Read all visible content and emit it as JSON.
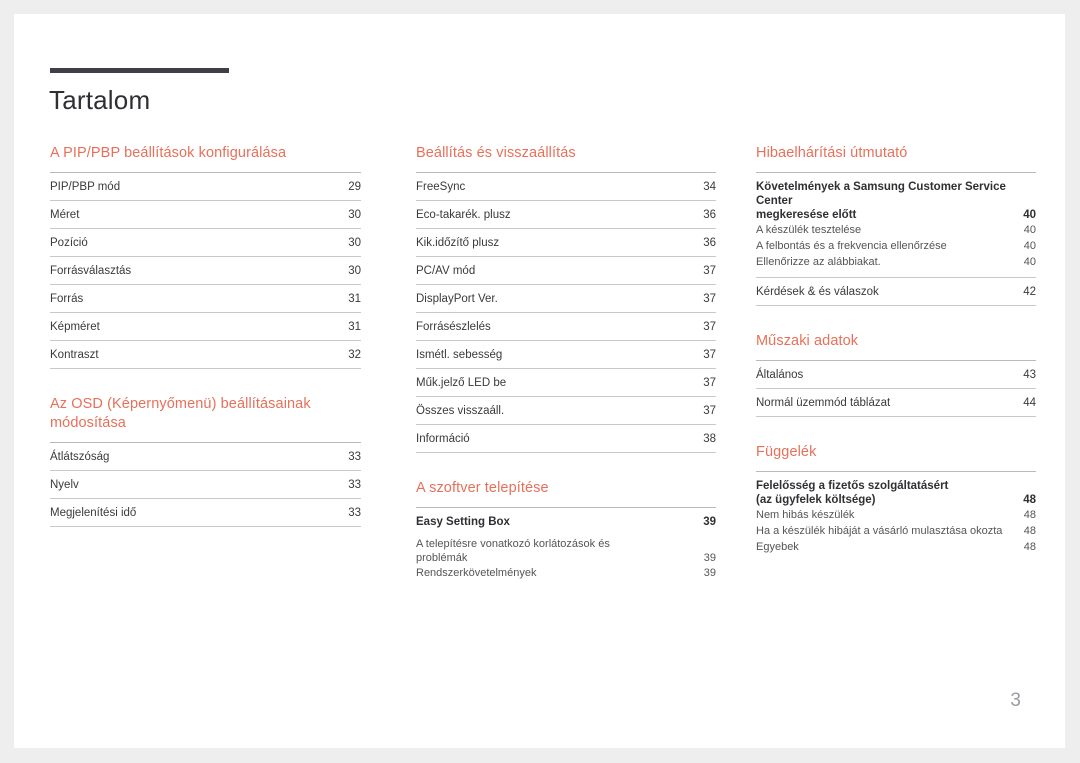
{
  "document": {
    "title": "Tartalom",
    "page_number": "3",
    "accent_color": "#e8705a",
    "rule_color": "#3f3f4a"
  },
  "columns": [
    {
      "sections": [
        {
          "heading": "A PIP/PBP beállítások konfigurálása",
          "entries": [
            {
              "label": "PIP/PBP mód",
              "page": "29",
              "style": "row"
            },
            {
              "label": "Méret",
              "page": "30",
              "style": "row"
            },
            {
              "label": "Pozíció",
              "page": "30",
              "style": "row"
            },
            {
              "label": "Forrásválasztás",
              "page": "30",
              "style": "row"
            },
            {
              "label": "Forrás",
              "page": "31",
              "style": "row"
            },
            {
              "label": "Képméret",
              "page": "31",
              "style": "row"
            },
            {
              "label": "Kontraszt",
              "page": "32",
              "style": "row"
            }
          ]
        },
        {
          "heading": "Az OSD (Képernyőmenü) beállításainak módosítása",
          "entries": [
            {
              "label": "Átlátszóság",
              "page": "33",
              "style": "row"
            },
            {
              "label": "Nyelv",
              "page": "33",
              "style": "row"
            },
            {
              "label": "Megjelenítési idő",
              "page": "33",
              "style": "row"
            }
          ]
        }
      ]
    },
    {
      "sections": [
        {
          "heading": "Beállítás és visszaállítás",
          "entries": [
            {
              "label": "FreeSync",
              "page": "34",
              "style": "row"
            },
            {
              "label": "Eco-takarék. plusz",
              "page": "36",
              "style": "row"
            },
            {
              "label": "Kik.időzítő plusz",
              "page": "36",
              "style": "row"
            },
            {
              "label": "PC/AV mód",
              "page": "37",
              "style": "row"
            },
            {
              "label": "DisplayPort Ver.",
              "page": "37",
              "style": "row"
            },
            {
              "label": "Forrásészlelés",
              "page": "37",
              "style": "row"
            },
            {
              "label": "Ismétl. sebesség",
              "page": "37",
              "style": "row"
            },
            {
              "label": "Műk.jelző LED be",
              "page": "37",
              "style": "row"
            },
            {
              "label": "Összes visszaáll.",
              "page": "37",
              "style": "row"
            },
            {
              "label": "Információ",
              "page": "38",
              "style": "row"
            }
          ]
        },
        {
          "heading": "A szoftver telepítése",
          "entries": [
            {
              "label": "Easy Setting Box",
              "page": "39",
              "style": "main-no-rule"
            },
            {
              "label_line1": "A telepítésre vonatkozó korlátozások és",
              "label_line2": "problémák",
              "page": "39",
              "style": "sub-wrap"
            },
            {
              "label": "Rendszerkövetelmények",
              "page": "39",
              "style": "sub"
            }
          ]
        }
      ]
    },
    {
      "sections": [
        {
          "heading": "Hibaelhárítási útmutató",
          "entries": [
            {
              "label_line1": "Követelmények a Samsung Customer Service Center",
              "label_line2": "megkeresése előtt",
              "page": "40",
              "style": "main-wrap"
            },
            {
              "label": "A készülék tesztelése",
              "page": "40",
              "style": "sub"
            },
            {
              "label": "A felbontás és a frekvencia ellenőrzése",
              "page": "40",
              "style": "sub"
            },
            {
              "label": "Ellenőrizze az alábbiakat.",
              "page": "40",
              "style": "sub"
            },
            {
              "label": "Kérdések & és válaszok",
              "page": "42",
              "style": "row-top-rule"
            }
          ]
        },
        {
          "heading": "Műszaki adatok",
          "entries": [
            {
              "label": "Általános",
              "page": "43",
              "style": "row"
            },
            {
              "label": "Normál üzemmód táblázat",
              "page": "44",
              "style": "row"
            }
          ]
        },
        {
          "heading": "Függelék",
          "entries": [
            {
              "label_line1": "Felelősség a fizetős szolgáltatásért",
              "label_line2": "(az ügyfelek költsége)",
              "page": "48",
              "style": "main-wrap"
            },
            {
              "label": "Nem hibás készülék",
              "page": "48",
              "style": "sub"
            },
            {
              "label": "Ha a készülék hibáját a vásárló mulasztása okozta",
              "page": "48",
              "style": "sub"
            },
            {
              "label": "Egyebek",
              "page": "48",
              "style": "sub"
            }
          ]
        }
      ]
    }
  ]
}
